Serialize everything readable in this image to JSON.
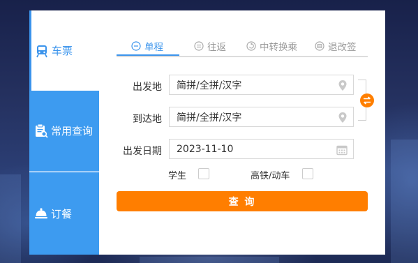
{
  "sidebar": {
    "items": [
      {
        "label": "车票",
        "icon": "train-icon",
        "active": true
      },
      {
        "label": "常用查询",
        "icon": "clipboard-search-icon",
        "active": false
      },
      {
        "label": "订餐",
        "icon": "food-cover-icon",
        "active": false
      }
    ]
  },
  "tabs": [
    {
      "label": "单程",
      "icon": "minus-circle-icon",
      "active": true
    },
    {
      "label": "往返",
      "icon": "equals-circle-icon",
      "active": false
    },
    {
      "label": "中转换乘",
      "icon": "transfer-circle-icon",
      "active": false
    },
    {
      "label": "退改签",
      "icon": "ticket-circle-icon",
      "active": false
    }
  ],
  "form": {
    "from_label": "出发地",
    "from_value": "简拼/全拼/汉字",
    "to_label": "到达地",
    "to_value": "简拼/全拼/汉字",
    "date_label": "出发日期",
    "date_value": "2023-11-10",
    "student_label": "学生",
    "student_checked": false,
    "highspeed_label": "高铁/动车",
    "highspeed_checked": false,
    "submit_label": "查 询"
  },
  "colors": {
    "accent_blue": "#3b94ec",
    "sidebar_blue": "#3d9bf0",
    "accent_orange": "#ff7e00"
  }
}
